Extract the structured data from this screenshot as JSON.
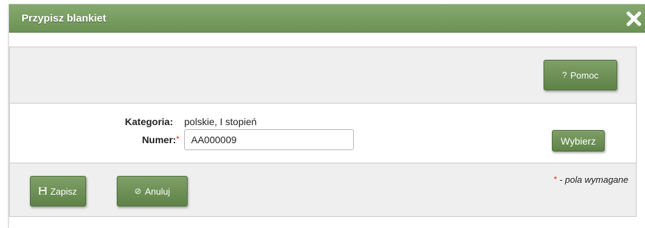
{
  "dialog": {
    "title": "Przypisz blankiet",
    "close_icon": "close-x-icon"
  },
  "toolbar": {
    "help_icon": "question-mark-icon",
    "help_icon_glyph": "?",
    "help_label": "Pomoc"
  },
  "form": {
    "category_label": "Kategoria:",
    "category_value": "polskie, I stopień",
    "number_label": "Numer:",
    "required_marker": "*",
    "number_value": "AA000009",
    "pick_label": "Wybierz"
  },
  "footer": {
    "save_icon": "floppy-disk-icon",
    "save_label": "Zapisz",
    "cancel_icon": "cancel-circle-icon",
    "cancel_icon_glyph": "⊘",
    "cancel_label": "Anuluj",
    "required_marker": "*",
    "required_note": " - pola wymagane"
  },
  "colors": {
    "accent": "#6c9255",
    "button": "#6b8f53",
    "required": "#d9261c",
    "panel_bg": "#efefef"
  }
}
